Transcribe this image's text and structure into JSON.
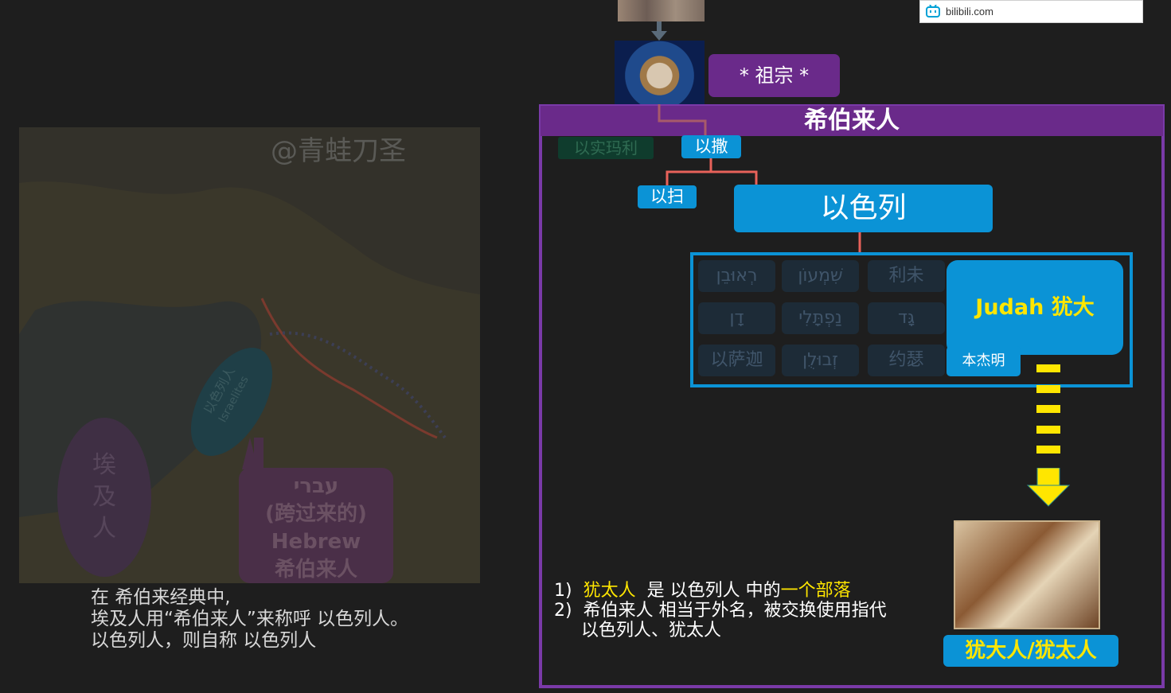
{
  "browser": {
    "url": "bilibili.com"
  },
  "map": {
    "watermark": "@青蛙刀圣",
    "region_label_cn": "以色列人",
    "region_label_en": "Israelites",
    "egypt_label": "埃及人",
    "hebrew_label_lines": [
      "עברי",
      "(跨过来的)",
      "Hebrew",
      "希伯来人"
    ]
  },
  "caption_lines": [
    "在 希伯来经典中,",
    "埃及人用“希伯来人”来称呼 以色列人。",
    "以色列人，则自称 以色列人"
  ],
  "tree": {
    "ancestor": "* 祖宗 *",
    "hebrew_title": "希伯来人",
    "ishmael": "以实玛利",
    "isaac": "以撒",
    "esau": "以扫",
    "israel": "以色列",
    "tribes": [
      "רְאוּבֵן",
      "שִׁמְעוֹן",
      "利未",
      "דָן",
      "נַפְתָּלִי",
      "גָּד",
      "以萨迦",
      "זְבוּלֻן",
      "约瑟"
    ],
    "judah": "Judah 犹大",
    "benjamin": "本杰明",
    "jews": "犹大人/犹太人"
  },
  "notes": {
    "n1_num": "1)",
    "n1_a": "犹太人",
    "n1_b": "是 以色列人 中的",
    "n1_c": "一个部落",
    "n2_num": "2)",
    "n2_line1": "希伯来人 相当于外名，被交换使用指代",
    "n2_line2": "以色列人、犹太人"
  },
  "colors": {
    "purple": "#6a2a8a",
    "blue": "#0b93d6",
    "yellow": "#ffe600",
    "connector": "#e8625a"
  }
}
